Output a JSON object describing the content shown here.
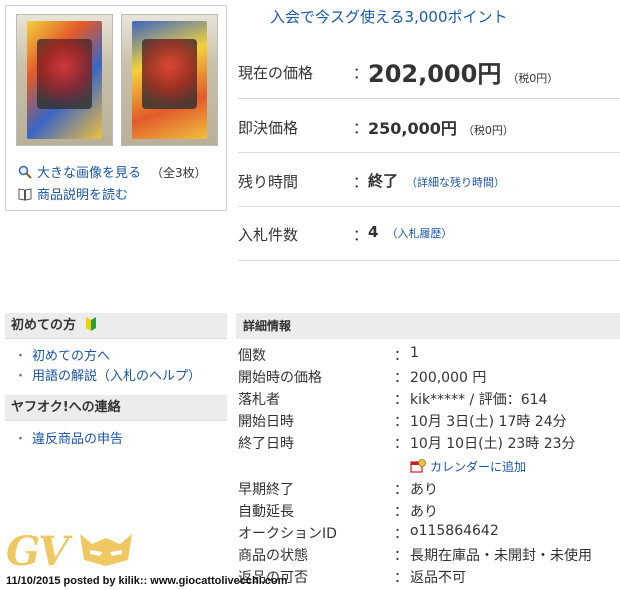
{
  "images": {
    "view_large": "大きな画像を見る",
    "count": "（全3枚）",
    "read_desc": "商品説明を読む"
  },
  "promo": "入会で今スグ使える3,000ポイント",
  "price": {
    "current_label": "現在の価格",
    "current_value": "202,000円",
    "current_tax": "（税0円）",
    "buyout_label": "即決価格",
    "buyout_value": "250,000円",
    "buyout_tax": "（税0円）",
    "remain_label": "残り時間",
    "remain_value": "終了",
    "remain_link": "（詳細な残り時間）",
    "bids_label": "入札件数",
    "bids_value": "4",
    "bids_link": "（入札履歴）",
    "colon": "："
  },
  "sidebar": {
    "first_head": "初めての方",
    "first_items": [
      "初めての方へ",
      "用語の解説（入札のヘルプ）"
    ],
    "contact_head": "ヤフオク!への連絡",
    "contact_items": [
      "違反商品の申告"
    ],
    "bullet": "・"
  },
  "details": {
    "head": "詳細情報",
    "rows": [
      {
        "label": "個数",
        "value": "1"
      },
      {
        "label": "開始時の価格",
        "value": "200,000 円"
      },
      {
        "label": "落札者",
        "value": "kik***** / 評価：614"
      },
      {
        "label": "開始日時",
        "value": "10月 3日(土) 17時 24分"
      },
      {
        "label": "終了日時",
        "value": "10月 10日(土) 23時 23分"
      },
      {
        "label": "早期終了",
        "value": "あり"
      },
      {
        "label": "自動延長",
        "value": "あり"
      },
      {
        "label": "オークションID",
        "value": "o115864642"
      },
      {
        "label": "商品の状態",
        "value": "長期在庫品・未開封・未使用"
      },
      {
        "label": "返品の可否",
        "value": "返品不可"
      }
    ],
    "calendar_link": "カレンダーに追加"
  },
  "watermark": {
    "logo_text": "GV",
    "footer": "11/10/2015 posted by kilik:: www.giocattolivecchi.com"
  },
  "colors": {
    "link": "#1a55a8",
    "header_bg": "#ececec",
    "logo": "#f0c862"
  },
  "icons": [
    "magnifier-icon",
    "book-icon",
    "beginner-mark-icon",
    "calendar-icon"
  ]
}
